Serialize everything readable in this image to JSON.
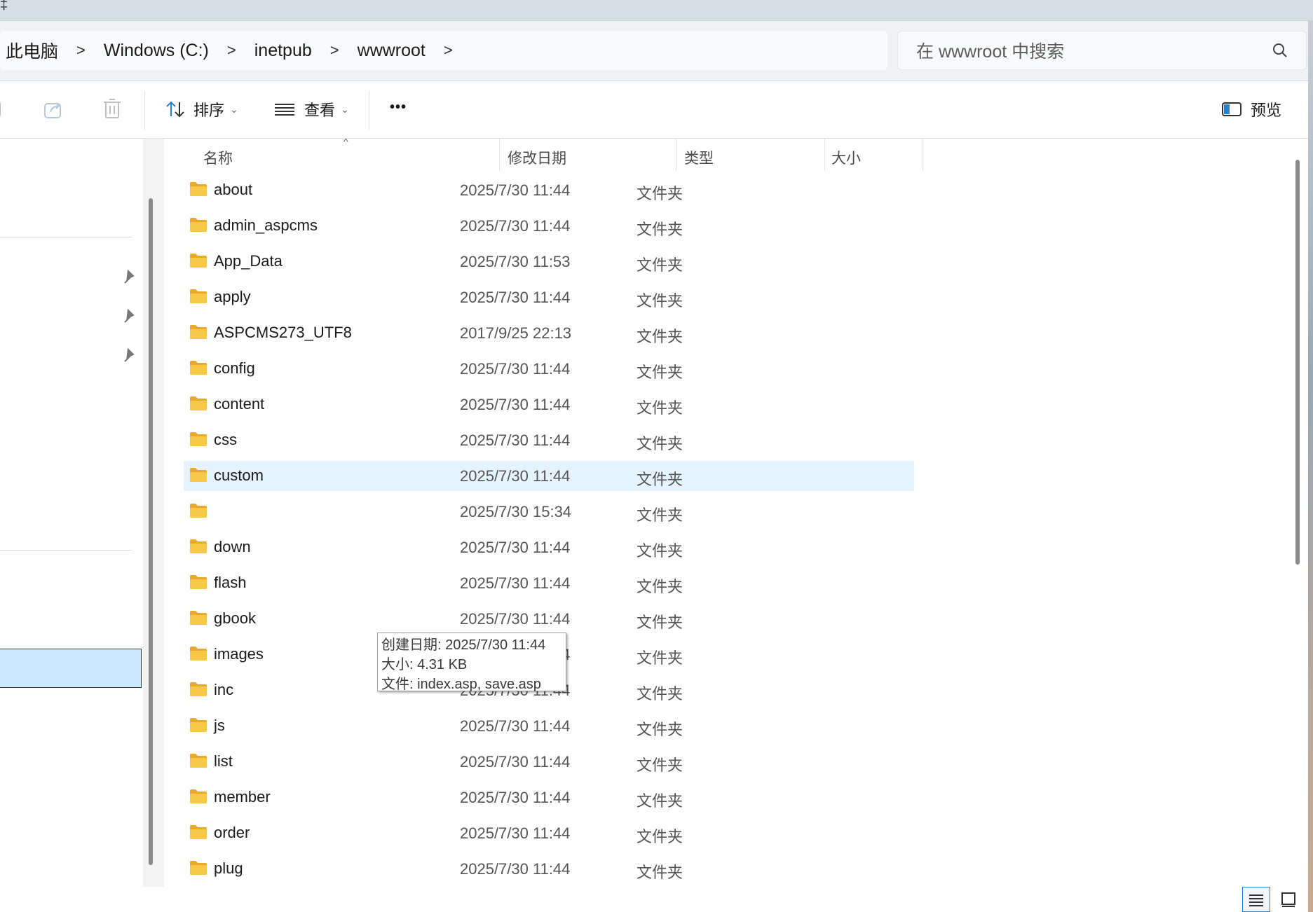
{
  "title_strip": {
    "glyph": "‡"
  },
  "breadcrumb": {
    "items": [
      "此电脑",
      "Windows (C:)",
      "inetpub",
      "wwwroot"
    ],
    "separator": ">"
  },
  "search": {
    "placeholder": "在 wwwroot 中搜索"
  },
  "toolbar": {
    "sort_label": "排序",
    "view_label": "查看",
    "more_label": "•••",
    "preview_label": "预览"
  },
  "columns": {
    "name": "名称",
    "date": "修改日期",
    "type": "类型",
    "size": "大小"
  },
  "files": [
    {
      "name": "about",
      "date": "2025/7/30 11:44",
      "type": "文件夹",
      "size": ""
    },
    {
      "name": "admin_aspcms",
      "date": "2025/7/30 11:44",
      "type": "文件夹",
      "size": ""
    },
    {
      "name": "App_Data",
      "date": "2025/7/30 11:53",
      "type": "文件夹",
      "size": ""
    },
    {
      "name": "apply",
      "date": "2025/7/30 11:44",
      "type": "文件夹",
      "size": ""
    },
    {
      "name": "ASPCMS273_UTF8",
      "date": "2017/9/25 22:13",
      "type": "文件夹",
      "size": ""
    },
    {
      "name": "config",
      "date": "2025/7/30 11:44",
      "type": "文件夹",
      "size": ""
    },
    {
      "name": "content",
      "date": "2025/7/30 11:44",
      "type": "文件夹",
      "size": ""
    },
    {
      "name": "css",
      "date": "2025/7/30 11:44",
      "type": "文件夹",
      "size": ""
    },
    {
      "name": "custom",
      "date": "2025/7/30 11:44",
      "type": "文件夹",
      "size": ""
    },
    {
      "name": "",
      "date": "2025/7/30 15:34",
      "type": "文件夹",
      "size": ""
    },
    {
      "name": "down",
      "date": "2025/7/30 11:44",
      "type": "文件夹",
      "size": ""
    },
    {
      "name": "flash",
      "date": "2025/7/30 11:44",
      "type": "文件夹",
      "size": ""
    },
    {
      "name": "gbook",
      "date": "2025/7/30 11:44",
      "type": "文件夹",
      "size": ""
    },
    {
      "name": "images",
      "date": "2025/7/30 11:44",
      "type": "文件夹",
      "size": ""
    },
    {
      "name": "inc",
      "date": "2025/7/30 11:44",
      "type": "文件夹",
      "size": ""
    },
    {
      "name": "js",
      "date": "2025/7/30 11:44",
      "type": "文件夹",
      "size": ""
    },
    {
      "name": "list",
      "date": "2025/7/30 11:44",
      "type": "文件夹",
      "size": ""
    },
    {
      "name": "member",
      "date": "2025/7/30 11:44",
      "type": "文件夹",
      "size": ""
    },
    {
      "name": "order",
      "date": "2025/7/30 11:44",
      "type": "文件夹",
      "size": ""
    },
    {
      "name": "plug",
      "date": "2025/7/30 11:44",
      "type": "文件夹",
      "size": ""
    }
  ],
  "hovered_row": "custom",
  "tooltip": {
    "created": "创建日期: 2025/7/30 11:44",
    "size": "大小: 4.31 KB",
    "files": "文件: index.asp, save.asp"
  },
  "colors": {
    "accent": "#2d7fd2",
    "hover_row": "#e5f3fe",
    "nav_selected": "#cce8ff",
    "folder_yellow": "#f8c84a"
  },
  "icons": [
    "copy-icon",
    "share-icon",
    "delete-icon",
    "sort-icon",
    "view-list-icon",
    "more-icon",
    "preview-pane-icon",
    "search-icon",
    "pin-icon",
    "folder-icon",
    "details-view-icon",
    "tiles-view-icon"
  ]
}
